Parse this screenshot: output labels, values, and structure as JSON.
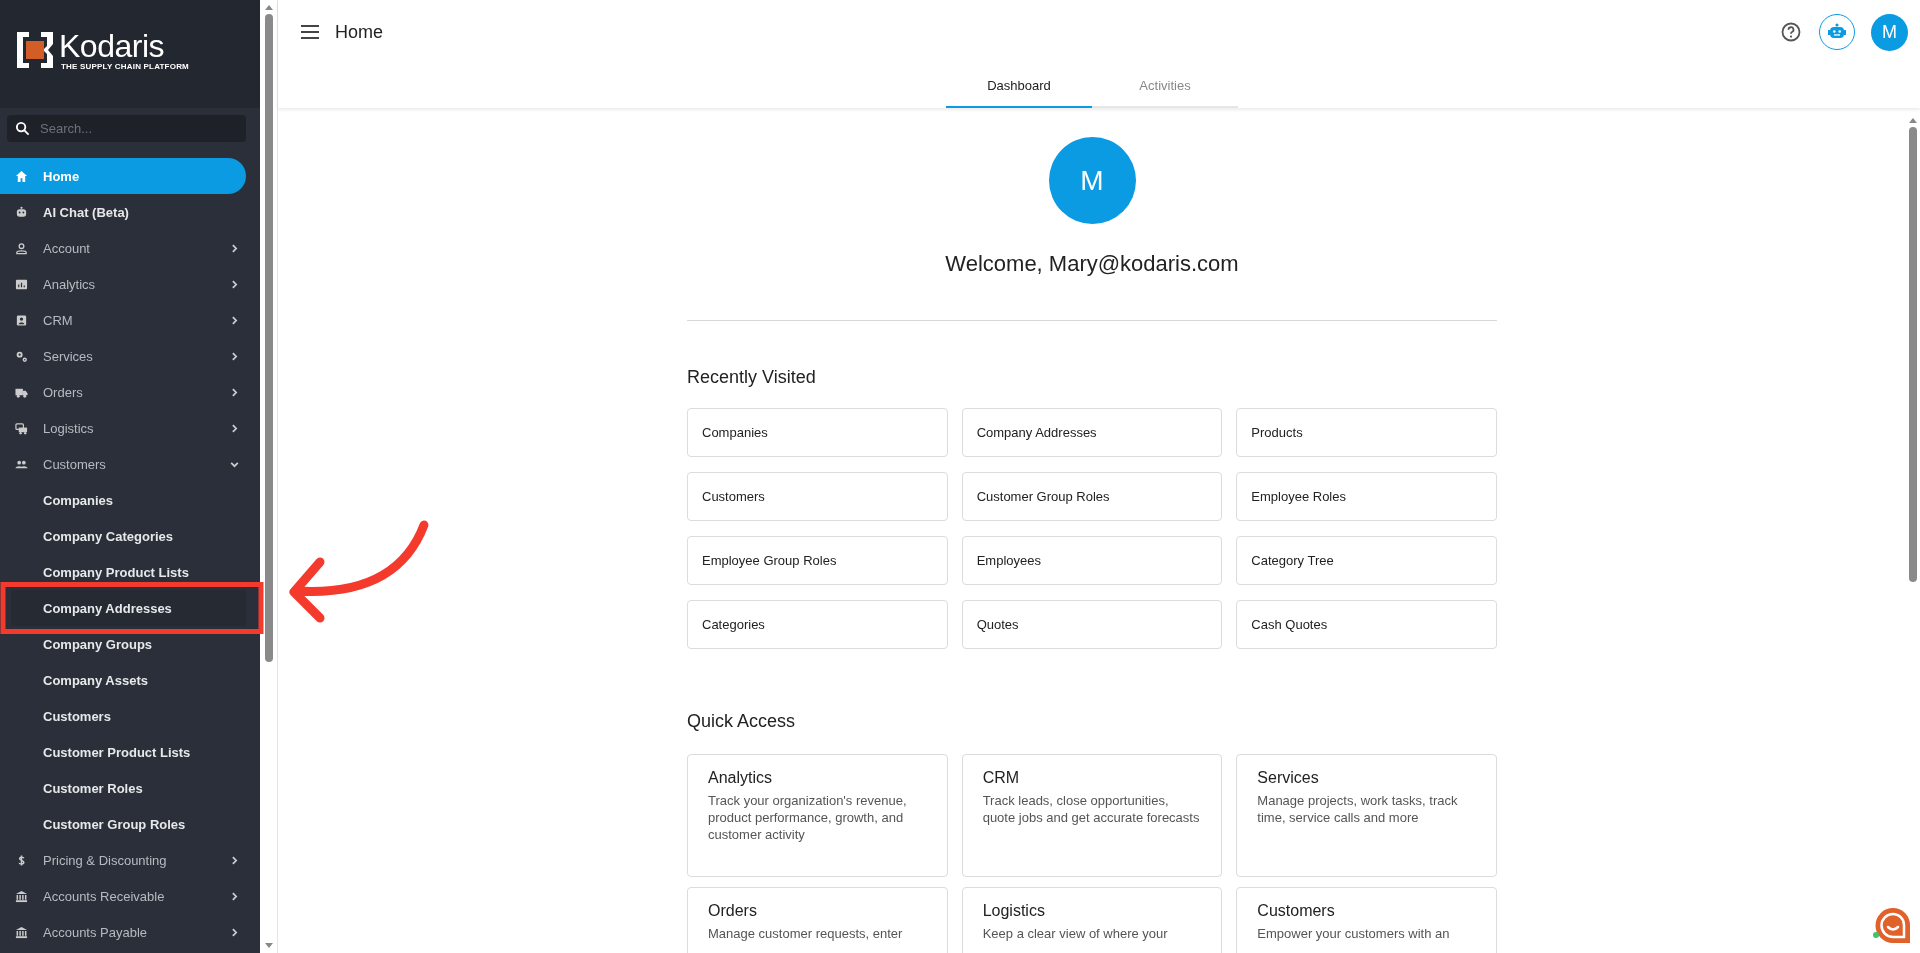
{
  "logo": {
    "name": "Kodaris",
    "tagline": "THE SUPPLY CHAIN PLATFORM"
  },
  "search": {
    "placeholder": "Search..."
  },
  "sidebar": {
    "items": [
      {
        "label": "Home",
        "selected": true,
        "kind": "leaf"
      },
      {
        "label": "AI Chat (Beta)",
        "selected": false,
        "kind": "leaf"
      },
      {
        "label": "Account",
        "selected": false,
        "expanded": false,
        "kind": "group"
      },
      {
        "label": "Analytics",
        "selected": false,
        "expanded": false,
        "kind": "group"
      },
      {
        "label": "CRM",
        "selected": false,
        "expanded": false,
        "kind": "group"
      },
      {
        "label": "Services",
        "selected": false,
        "expanded": false,
        "kind": "group"
      },
      {
        "label": "Orders",
        "selected": false,
        "expanded": false,
        "kind": "group"
      },
      {
        "label": "Logistics",
        "selected": false,
        "expanded": false,
        "kind": "group"
      },
      {
        "label": "Customers",
        "selected": false,
        "expanded": true,
        "kind": "group",
        "children": [
          {
            "label": "Companies",
            "selected": false
          },
          {
            "label": "Company Categories",
            "selected": false
          },
          {
            "label": "Company Product Lists",
            "selected": false
          },
          {
            "label": "Company Addresses",
            "selected": true
          },
          {
            "label": "Company Groups",
            "selected": false
          },
          {
            "label": "Company Assets",
            "selected": false
          },
          {
            "label": "Customers",
            "selected": false
          },
          {
            "label": "Customer Product Lists",
            "selected": false
          },
          {
            "label": "Customer Roles",
            "selected": false
          },
          {
            "label": "Customer Group Roles",
            "selected": false
          }
        ]
      },
      {
        "label": "Pricing & Discounting",
        "selected": false,
        "expanded": false,
        "kind": "group"
      },
      {
        "label": "Accounts Receivable",
        "selected": false,
        "expanded": false,
        "kind": "group"
      },
      {
        "label": "Accounts Payable",
        "selected": false,
        "expanded": false,
        "kind": "group"
      }
    ]
  },
  "top_bar": {
    "title": "Home",
    "avatar": "M"
  },
  "tabs": [
    {
      "label": "Dashboard",
      "selected": true
    },
    {
      "label": "Activities",
      "selected": false
    }
  ],
  "profile": {
    "avatar": "M",
    "welcome": "Welcome, Mary@kodaris.com"
  },
  "recently_visited": {
    "title": "Recently Visited",
    "items": [
      "Companies",
      "Company Addresses",
      "Products",
      "Customers",
      "Customer Group Roles",
      "Employee Roles",
      "Employee Group Roles",
      "Employees",
      "Category Tree",
      "Categories",
      "Quotes",
      "Cash Quotes"
    ]
  },
  "quick_access": {
    "title": "Quick Access",
    "items": [
      {
        "title": "Analytics",
        "description": "Track your organization's revenue, product performance, growth, and customer activity"
      },
      {
        "title": "CRM",
        "description": "Track leads, close opportunities, quote jobs and get accurate forecasts"
      },
      {
        "title": "Services",
        "description": "Manage projects, work tasks, track time, service calls and more"
      },
      {
        "title": "Orders",
        "description": "Manage customer requests, enter"
      },
      {
        "title": "Logistics",
        "description": "Keep a clear view of where your"
      },
      {
        "title": "Customers",
        "description": "Empower your customers with an"
      }
    ]
  }
}
